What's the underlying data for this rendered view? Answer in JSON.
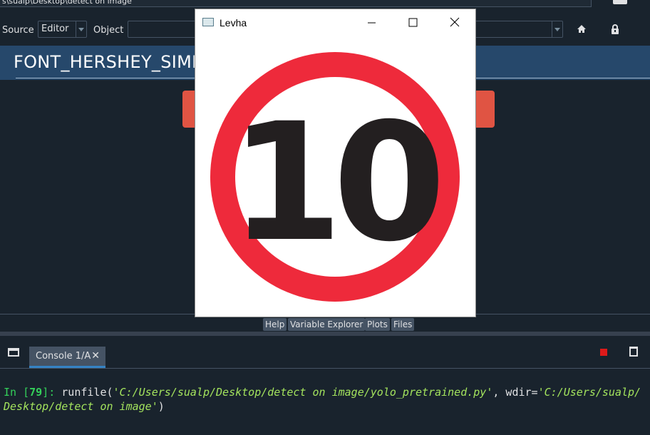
{
  "path_bar": {
    "value": "s\\sualp\\Desktop\\detect on image"
  },
  "help_toolbar": {
    "source_label": "Source",
    "source_value": "Editor",
    "object_label": "Object",
    "object_value": ""
  },
  "help_content": {
    "heading": "FONT_HERSHEY_SIMPLEX"
  },
  "pane_tabs": [
    {
      "label": "Help"
    },
    {
      "label": "Variable Explorer"
    },
    {
      "label": "Plots"
    },
    {
      "label": "Files"
    }
  ],
  "console": {
    "tab_label": "Console 1/A",
    "prompt_prefix": "In [",
    "prompt_number": "79",
    "prompt_suffix": "]: ",
    "call": "runfile(",
    "arg1": "'C:/Users/sualp/Desktop/detect on image/yolo_pretrained.py'",
    "sep": ", wdir=",
    "arg2_line1": "'C:/Users/sualp/",
    "arg2_line2": "Desktop/detect on image'",
    "close_paren": ")"
  },
  "popup_window": {
    "title": "Levha",
    "sign_text": "10",
    "sign_ring_color": "#ee2a3b",
    "sign_text_color": "#231f20"
  },
  "colors": {
    "background": "#19232d",
    "heading_band": "#26486b",
    "banner": "#e05443",
    "accent": "#3583c5",
    "stop": "#dd1a1a"
  },
  "icons": [
    "folder-icon",
    "home-icon",
    "lock-icon",
    "window-icon",
    "stop-icon",
    "trash-icon",
    "close-icon",
    "minimize-icon",
    "maximize-icon",
    "app-icon"
  ]
}
